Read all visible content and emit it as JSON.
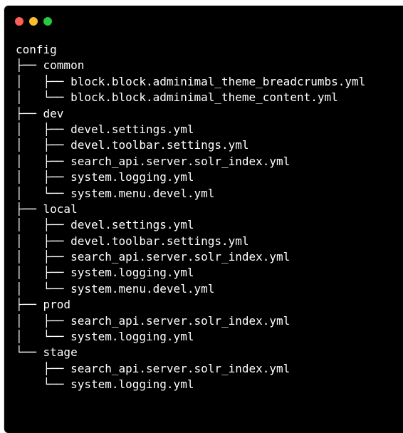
{
  "window": {
    "buttons": {
      "close": "close",
      "minimize": "minimize",
      "zoom": "zoom"
    }
  },
  "tree": {
    "lines": [
      {
        "branch": "",
        "name": "config"
      },
      {
        "branch": "├── ",
        "name": "common"
      },
      {
        "branch": "│   ├── ",
        "name": "block.block.adminimal_theme_breadcrumbs.yml"
      },
      {
        "branch": "│   └── ",
        "name": "block.block.adminimal_theme_content.yml"
      },
      {
        "branch": "├── ",
        "name": "dev"
      },
      {
        "branch": "│   ├── ",
        "name": "devel.settings.yml"
      },
      {
        "branch": "│   ├── ",
        "name": "devel.toolbar.settings.yml"
      },
      {
        "branch": "│   ├── ",
        "name": "search_api.server.solr_index.yml"
      },
      {
        "branch": "│   ├── ",
        "name": "system.logging.yml"
      },
      {
        "branch": "│   └── ",
        "name": "system.menu.devel.yml"
      },
      {
        "branch": "├── ",
        "name": "local"
      },
      {
        "branch": "│   ├── ",
        "name": "devel.settings.yml"
      },
      {
        "branch": "│   ├── ",
        "name": "devel.toolbar.settings.yml"
      },
      {
        "branch": "│   ├── ",
        "name": "search_api.server.solr_index.yml"
      },
      {
        "branch": "│   ├── ",
        "name": "system.logging.yml"
      },
      {
        "branch": "│   └── ",
        "name": "system.menu.devel.yml"
      },
      {
        "branch": "├── ",
        "name": "prod"
      },
      {
        "branch": "│   ├── ",
        "name": "search_api.server.solr_index.yml"
      },
      {
        "branch": "│   └── ",
        "name": "system.logging.yml"
      },
      {
        "branch": "└── ",
        "name": "stage"
      },
      {
        "branch": "    ├── ",
        "name": "search_api.server.solr_index.yml"
      },
      {
        "branch": "    └── ",
        "name": "system.logging.yml"
      }
    ]
  },
  "colors": {
    "background": "#000000",
    "text": "#ffffff",
    "close": "#ff5f56",
    "minimize": "#ffbd2e",
    "zoom": "#27c93f"
  }
}
